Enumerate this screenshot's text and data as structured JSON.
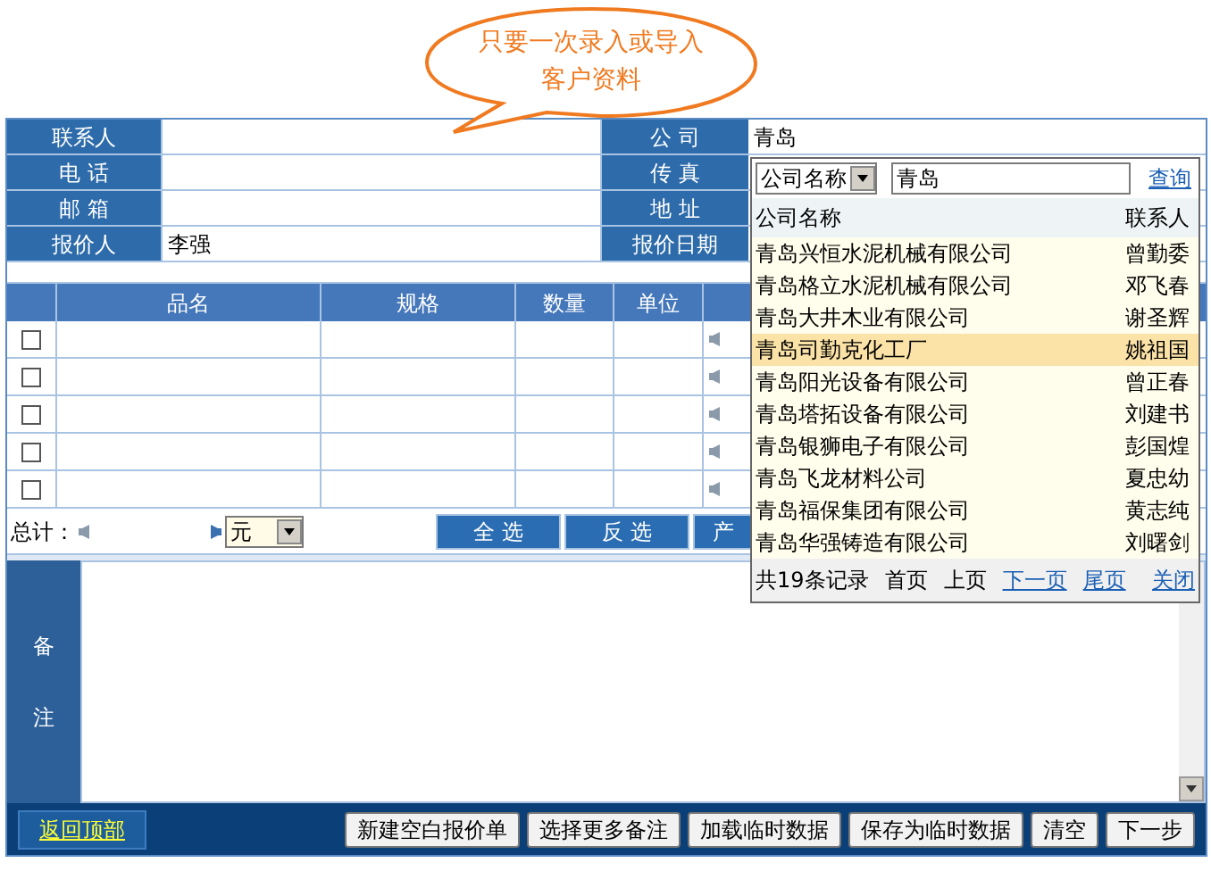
{
  "callout": {
    "lines": [
      "只要一次录入或导入",
      "客户资料"
    ]
  },
  "form": {
    "rows": [
      {
        "label": "联系人",
        "value": "",
        "right_label": "公 司",
        "right_value": "青岛"
      },
      {
        "label": "电 话",
        "value": "",
        "right_label": "传 真"
      },
      {
        "label": "邮 箱",
        "value": "",
        "right_label": "地 址"
      },
      {
        "label": "报价人",
        "value": "李强",
        "right_label": "报价日期"
      }
    ]
  },
  "table": {
    "columns": [
      "品名",
      "规格",
      "数量",
      "单位"
    ],
    "rows": [
      {
        "checked": false
      },
      {
        "checked": false
      },
      {
        "checked": false
      },
      {
        "checked": false
      },
      {
        "checked": false
      }
    ]
  },
  "totals": {
    "label": "总计：",
    "currency": "元",
    "buttons": [
      "全 选",
      "反 选",
      "产"
    ]
  },
  "remarks": {
    "label": "备注"
  },
  "popup": {
    "search_field": "公司名称",
    "query": "青岛",
    "search_link": "查询",
    "columns": [
      "公司名称",
      "联系人"
    ],
    "rows": [
      {
        "company": "青岛兴恒水泥机械有限公司",
        "contact": "曾勤委",
        "selected": false
      },
      {
        "company": "青岛格立水泥机械有限公司",
        "contact": "邓飞春",
        "selected": false
      },
      {
        "company": "青岛大井木业有限公司",
        "contact": "谢圣辉",
        "selected": false
      },
      {
        "company": "青岛司勤克化工厂",
        "contact": "姚祖国",
        "selected": true
      },
      {
        "company": "青岛阳光设备有限公司",
        "contact": "曾正春",
        "selected": false
      },
      {
        "company": "青岛塔拓设备有限公司",
        "contact": "刘建书",
        "selected": false
      },
      {
        "company": "青岛银狮电子有限公司",
        "contact": "彭国煌",
        "selected": false
      },
      {
        "company": "青岛飞龙材料公司",
        "contact": "夏忠幼",
        "selected": false
      },
      {
        "company": "青岛福保集团有限公司",
        "contact": "黄志纯",
        "selected": false
      },
      {
        "company": "青岛华强铸造有限公司",
        "contact": "刘曙剑",
        "selected": false
      }
    ],
    "footer": {
      "count": "共19条记录",
      "pages": [
        {
          "label": "首页",
          "disabled": true
        },
        {
          "label": "上页",
          "disabled": true
        },
        {
          "label": "下一页",
          "disabled": false
        },
        {
          "label": "尾页",
          "disabled": false
        }
      ],
      "close": "关闭"
    }
  },
  "bottom": {
    "back_link": "返回顶部",
    "buttons": [
      "新建空白报价单",
      "选择更多备注",
      "加载临时数据",
      "保存为临时数据",
      "清空",
      "下一步"
    ]
  }
}
